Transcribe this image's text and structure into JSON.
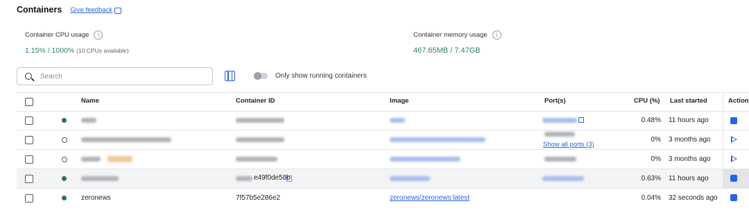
{
  "header": {
    "title": "Containers",
    "feedback_label": "Give feedback"
  },
  "stats": {
    "cpu": {
      "label": "Container CPU usage",
      "value": "1.15% / 1000%",
      "sub": "(10 CPUs available)"
    },
    "memory": {
      "label": "Container memory usage",
      "value": "467.65MB / 7.47GB"
    }
  },
  "toolbar": {
    "search_placeholder": "Search",
    "toggle_label": "Only show running containers"
  },
  "table": {
    "columns": [
      "Name",
      "Container ID",
      "Image",
      "Port(s)",
      "CPU (%)",
      "Last started",
      "Action"
    ],
    "rows": [
      {
        "status": "running",
        "cpu": "0.48%",
        "last_started": "11 hours ago",
        "action": "stop"
      },
      {
        "status": "stopped",
        "ports_link": "Show all ports (3)",
        "cpu": "0%",
        "last_started": "3 months ago",
        "action": "start"
      },
      {
        "status": "stopped",
        "cpu": "0%",
        "last_started": "3 months ago",
        "action": "start"
      },
      {
        "status": "running",
        "id_suffix": "e49f0de58b",
        "cpu": "0.63%",
        "last_started": "11 hours ago",
        "action": "stop"
      },
      {
        "status": "running",
        "name": "zeronews",
        "container_id": "7f57b5e286e2",
        "image": "zeronews/zeronews:latest",
        "cpu": "0.04%",
        "last_started": "32 seconds ago",
        "action": "stop"
      }
    ]
  },
  "colors": {
    "accent": "#2563eb",
    "running": "#2f6f5e",
    "stat_value": "#2f7d6a"
  },
  "icons": [
    "feedback-icon",
    "info-icon",
    "search-icon",
    "columns-icon",
    "external-link-icon",
    "copy-icon",
    "stop-icon",
    "play-icon"
  ]
}
